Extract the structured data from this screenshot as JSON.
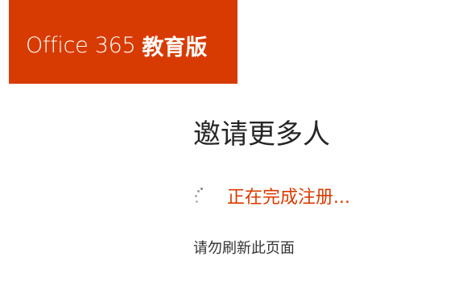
{
  "brand": {
    "product": "Office 365",
    "edition": "教育版",
    "color": "#d83b01"
  },
  "main": {
    "title": "邀请更多人",
    "status": "正在完成注册...",
    "hint": "请勿刷新此页面",
    "spinner_icon": "loading-spinner-icon",
    "status_color": "#d83b01"
  }
}
